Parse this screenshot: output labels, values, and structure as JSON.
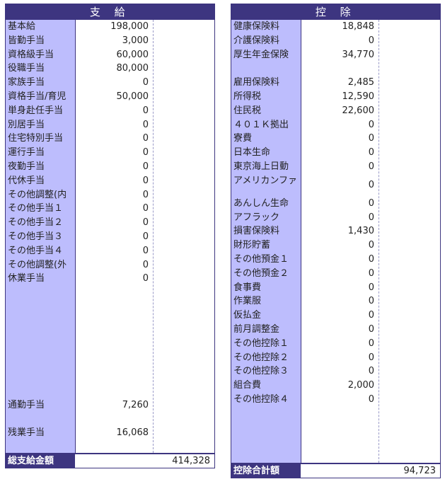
{
  "payment": {
    "title": "支 給",
    "items": [
      {
        "label": "基本給",
        "value": "198,000"
      },
      {
        "label": "皆勤手当",
        "value": "3,000"
      },
      {
        "label": "資格級手当",
        "value": "60,000"
      },
      {
        "label": "役職手当",
        "value": "80,000"
      },
      {
        "label": "家族手当",
        "value": "0"
      },
      {
        "label": "資格手当/育児",
        "value": "50,000"
      },
      {
        "label": "単身赴任手当",
        "value": "0"
      },
      {
        "label": "別居手当",
        "value": "0"
      },
      {
        "label": "住宅特別手当",
        "value": "0"
      },
      {
        "label": "運行手当",
        "value": "0"
      },
      {
        "label": "夜勤手当",
        "value": "0"
      },
      {
        "label": "代休手当",
        "value": "0"
      },
      {
        "label": "その他調整(内",
        "value": "0"
      },
      {
        "label": "その他手当１",
        "value": "0"
      },
      {
        "label": "その他手当２",
        "value": "0"
      },
      {
        "label": "その他手当３",
        "value": "0"
      },
      {
        "label": "その他手当４",
        "value": "0"
      },
      {
        "label": "その他調整(外",
        "value": "0"
      },
      {
        "label": "休業手当",
        "value": "0"
      }
    ],
    "commute": {
      "label": "通勤手当",
      "value": "7,260"
    },
    "overtime": {
      "label": "残業手当",
      "value": "16,068"
    },
    "total_label": "総支給金額",
    "total_value": "414,328"
  },
  "deduction": {
    "title": "控 除",
    "items": [
      {
        "label": "健康保険料",
        "value": "18,848"
      },
      {
        "label": "介護保険料",
        "value": "0"
      },
      {
        "label": "厚生年金保険",
        "value": "34,770"
      },
      {
        "label": "",
        "value": ""
      },
      {
        "label": "雇用保険料",
        "value": "2,485"
      },
      {
        "label": "所得税",
        "value": "12,590"
      },
      {
        "label": "住民税",
        "value": "22,600"
      },
      {
        "label": "４０１Ｋ拠出",
        "value": "0"
      },
      {
        "label": "寮費",
        "value": "0"
      },
      {
        "label": "日本生命",
        "value": "0"
      },
      {
        "label": "東京海上日動",
        "value": "0"
      },
      {
        "label": "アメリカンファ",
        "value": "0",
        "tall": true
      },
      {
        "label": "あんしん生命",
        "value": "0"
      },
      {
        "label": "アフラック",
        "value": "0"
      },
      {
        "label": "損害保険料",
        "value": "1,430"
      },
      {
        "label": "財形貯蓄",
        "value": "0"
      },
      {
        "label": "その他預金１",
        "value": "0"
      },
      {
        "label": "その他預金２",
        "value": "0"
      },
      {
        "label": "食事費",
        "value": "0"
      },
      {
        "label": "作業服",
        "value": "0"
      },
      {
        "label": "仮払金",
        "value": "0"
      },
      {
        "label": "前月調整金",
        "value": "0"
      },
      {
        "label": "その他控除１",
        "value": "0"
      },
      {
        "label": "その他控除２",
        "value": "0"
      },
      {
        "label": "その他控除３",
        "value": "0"
      },
      {
        "label": "組合費",
        "value": "2,000"
      },
      {
        "label": "その他控除４",
        "value": "0"
      }
    ],
    "total_label": "控除合計額",
    "total_value": "94,723"
  }
}
